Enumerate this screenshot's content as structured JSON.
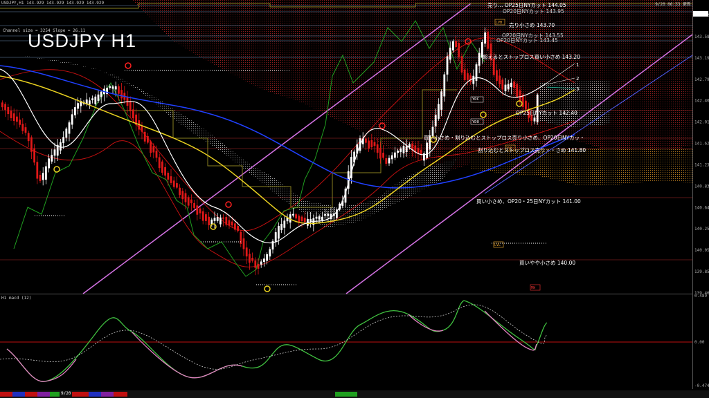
{
  "header": {
    "symbol_line": "USDJPY,H1  143.929 143.929 143.929 143.929",
    "datetime": "9/20 06:33 更新",
    "channel_info": "Channel size = 3254  Slope = 26.11",
    "title": "USDJPY H1",
    "macd_label": "H1  macd (12)"
  },
  "price_axis": [
    "143.929",
    "143.580",
    "143.190",
    "142.795",
    "142.405",
    "142.010",
    "141.620",
    "141.230",
    "140.835",
    "140.640",
    "140.250",
    "140.055",
    "139.855",
    "139.465"
  ],
  "macd_axis": [
    "0.489",
    "0.00",
    "-0.474"
  ],
  "levels": [
    {
      "label": "売り…  OP25日NYカット 144.05",
      "color": "#9bc8ff"
    },
    {
      "label": "OP20日NYカット 143.95",
      "color": "#9bc8ff"
    },
    {
      "label": "売り小さめ 143.70",
      "color": "#9bc8ff"
    },
    {
      "label": "OP20日NYカット 143.55",
      "color": "#9bc8ff"
    },
    {
      "label": "OP20日NYカット 143.45",
      "color": "#9bc8ff"
    },
    {
      "label": "超えるとストップロス買い小さめ 143.20",
      "color": "#9bc8ff"
    },
    {
      "label": "OP25日NYカット 142.40",
      "color": "#ff4040"
    },
    {
      "label": "買い小さめ・割り込むとストップロス売り小さめ、OP20日NYカッ・",
      "color": "#ff4040"
    },
    {
      "label": "割り込むとストップロス売り・・さめ 141.80",
      "color": "#ff4040"
    },
    {
      "label": "買い小さめ、OP20・25日NYカット 141.00",
      "color": "#ff4040"
    },
    {
      "label": "買いやや小さめ 140.00",
      "color": "#ff4040"
    }
  ],
  "channel_labels": [
    "1",
    "2",
    "3"
  ],
  "box_labels": {
    "lvh": "LVH",
    "lvl": "LVL",
    "yvh": "YVH",
    "ydc": "YDC",
    "ydo": "YDO",
    "mw": "MW"
  },
  "timeframe_label": "9/20",
  "colors": {
    "bull": "#ffffff",
    "bear": "#e01818",
    "bg": "#000000",
    "channel": "#d070e0",
    "ma_fast": "#ffffff",
    "ma_mid": "#e8d020",
    "ma_slow": "#2040ff",
    "bands": "#c01010",
    "cloud": "#8b1a1a",
    "macd_up": "#40c040",
    "macd_down": "#e080c0",
    "signal": "#cccccc",
    "lagging": "#20a020"
  }
}
